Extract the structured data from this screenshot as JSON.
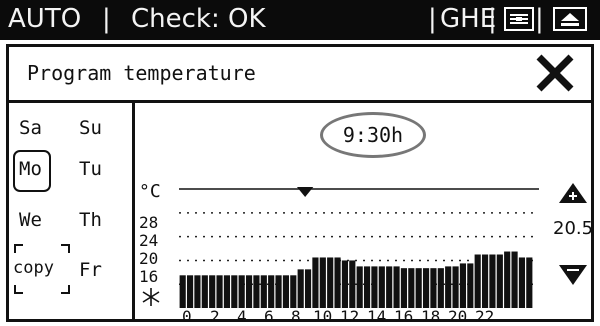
{
  "status_bar": {
    "mode": "AUTO",
    "separator": "|",
    "status": "Check: OK",
    "code": "GHE"
  },
  "dialog": {
    "title": "Program temperature",
    "close_icon": "close-icon"
  },
  "days": {
    "sa": "Sa",
    "su": "Su",
    "mo": "Mo",
    "tu": "Tu",
    "we": "We",
    "th": "Th",
    "copy": "copy",
    "fr": "Fr",
    "selected": "Mo"
  },
  "time": {
    "value": "9:30h",
    "prev_icon": "arrow-left-icon",
    "next_icon": "arrow-right-icon"
  },
  "setpoint": {
    "value": "20.5",
    "up_icon": "increase-icon",
    "down_icon": "decrease-icon"
  },
  "chart_data": {
    "type": "bar",
    "unit": "°C",
    "y_ticks": [
      "28",
      "24",
      "20",
      "16"
    ],
    "y_min_icon": "frost-icon",
    "x_ticks": [
      "0",
      "2",
      "4",
      "6",
      "8",
      "10",
      "12",
      "14",
      "16",
      "18",
      "20",
      "22"
    ],
    "ylim": [
      12,
      30
    ],
    "grid": true,
    "values": [
      17.5,
      17.5,
      17.5,
      17.5,
      17.5,
      17.5,
      17.5,
      17.5,
      17.5,
      17.5,
      17.5,
      17.5,
      17.5,
      17.5,
      17.5,
      17.5,
      18.5,
      18.5,
      20.5,
      20.5,
      20.5,
      20.5,
      20,
      20,
      19,
      19,
      19,
      19,
      19,
      19,
      18.7,
      18.7,
      18.7,
      18.7,
      18.7,
      18.7,
      19,
      19,
      19.5,
      19.5,
      21,
      21,
      21,
      21,
      21.5,
      21.5,
      20.5,
      20.5
    ]
  }
}
